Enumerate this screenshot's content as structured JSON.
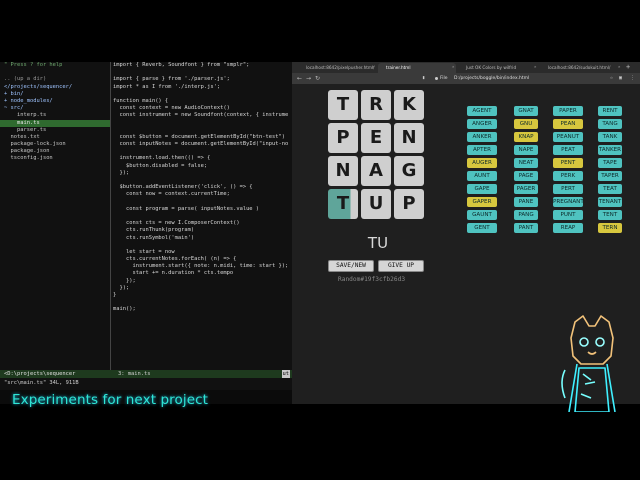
{
  "vim": {
    "tree": [
      {
        "t": "\" Press ? for help",
        "cls": "cmt"
      },
      {
        "t": "",
        "cls": ""
      },
      {
        "t": ".. (up a dir)",
        "cls": "dim"
      },
      {
        "t": "</projects/sequencer/",
        "cls": "dir"
      },
      {
        "t": "+ bin/",
        "cls": "dir"
      },
      {
        "t": "+ node_modules/",
        "cls": "dir"
      },
      {
        "t": "~ src/",
        "cls": "dir"
      },
      {
        "t": "    interp.ts",
        "cls": ""
      },
      {
        "t": "    main.ts",
        "cls": "sel"
      },
      {
        "t": "    parser.ts",
        "cls": ""
      },
      {
        "t": "  notes.txt",
        "cls": ""
      },
      {
        "t": "  package-lock.json",
        "cls": ""
      },
      {
        "t": "  package.json",
        "cls": ""
      },
      {
        "t": "  tsconfig.json",
        "cls": ""
      }
    ],
    "code": [
      "import { Reverb, Soundfont } from \"smplr\";",
      "",
      "import { parse } from './parser.js';",
      "import * as I from './interp.js';",
      "",
      "function main() {",
      "  const context = new AudioContext()",
      "  const instrument = new Soundfont(context, { instrume",
      "",
      "",
      "  const $button = document.getElementById(\"btn-test\")",
      "  const inputNotes = document.getElementById(\"input-no",
      "",
      "  instrument.load.then(() => {",
      "    $button.disabled = false;",
      "  });",
      "",
      "  $button.addEventListener('click', () => {",
      "    const now = context.currentTime;",
      "",
      "    const program = parse( inputNotes.value )",
      "",
      "    const cts = new I.ComposerContext()",
      "    cts.runThunk(program)",
      "    cts.runSymbol('main')",
      "",
      "    let start = now",
      "    cts.currentNotes.forEach( (n) => {",
      "      instrument.start({ note: n.midi, time: start });",
      "      start += n.duration * cts.tempo",
      "    });",
      "  });",
      "}",
      "",
      "main();"
    ],
    "status_left": "<D:\\projects\\sequencer",
    "status_right": "3: main.ts",
    "status_end": "ut",
    "cmdline": "\"src\\main.ts\" 34L, 911B"
  },
  "browser": {
    "tabs": [
      {
        "label": "localhost:8642/pixelpusher.html/",
        "active": false
      },
      {
        "label": "trainer.html",
        "active": true
      },
      {
        "label": "Just OK Colors by wilfrid",
        "active": false
      },
      {
        "label": "localhost:8642/sudokuit.html/",
        "active": false
      }
    ],
    "url_scheme": "File",
    "url_path": "D:/projects/boggle/bin/index.html",
    "board": [
      [
        "T",
        "R",
        "K"
      ],
      [
        "P",
        "E",
        "N"
      ],
      [
        "N",
        "A",
        "G"
      ],
      [
        "T",
        "U",
        "P"
      ]
    ],
    "highlighted_tile": {
      "row": 3,
      "col": 0
    },
    "current_word": "TU",
    "save_new_label": "SAVE/NEW",
    "give_up_label": "GIVE UP",
    "seed": "Random#19f3cfb26d3",
    "words": [
      [
        {
          "w": "AGENT",
          "f": false
        },
        {
          "w": "GNAT",
          "f": false
        },
        {
          "w": "PAPER",
          "f": false
        },
        {
          "w": "RENT",
          "f": false
        }
      ],
      [
        {
          "w": "ANGER",
          "f": false
        },
        {
          "w": "GNU",
          "f": true
        },
        {
          "w": "PEAN",
          "f": true
        },
        {
          "w": "TANG",
          "f": false
        }
      ],
      [
        {
          "w": "ANKER",
          "f": false
        },
        {
          "w": "KNAP",
          "f": true
        },
        {
          "w": "PEANUT",
          "f": false
        },
        {
          "w": "TANK",
          "f": false
        }
      ],
      [
        {
          "w": "APTER",
          "f": false
        },
        {
          "w": "NAPE",
          "f": false
        },
        {
          "w": "PEAT",
          "f": false
        },
        {
          "w": "TANKER",
          "f": false
        }
      ],
      [
        {
          "w": "AUGER",
          "f": true
        },
        {
          "w": "NEAT",
          "f": false
        },
        {
          "w": "PENT",
          "f": true
        },
        {
          "w": "TAPE",
          "f": false
        }
      ],
      [
        {
          "w": "AUNT",
          "f": false
        },
        {
          "w": "PAGE",
          "f": false
        },
        {
          "w": "PERK",
          "f": false
        },
        {
          "w": "TAPER",
          "f": false
        }
      ],
      [
        {
          "w": "GAPE",
          "f": false
        },
        {
          "w": "PAGER",
          "f": false
        },
        {
          "w": "PERT",
          "f": false
        },
        {
          "w": "TEAT",
          "f": false
        }
      ],
      [
        {
          "w": "GAPER",
          "f": true
        },
        {
          "w": "PANE",
          "f": false
        },
        {
          "w": "PREGNANT",
          "f": false
        },
        {
          "w": "TENANT",
          "f": false
        }
      ],
      [
        {
          "w": "GAUNT",
          "f": false
        },
        {
          "w": "PANG",
          "f": false
        },
        {
          "w": "PUNT",
          "f": false
        },
        {
          "w": "TENT",
          "f": false
        }
      ],
      [
        {
          "w": "GENT",
          "f": false
        },
        {
          "w": "PANT",
          "f": false
        },
        {
          "w": "REAP",
          "f": false
        },
        {
          "w": "TERN",
          "f": true
        }
      ]
    ]
  },
  "caption": "Experiments for next project",
  "colors": {
    "word_chip": "#4fc3c0",
    "found_chip": "#d7c73e",
    "caption": "#2fe6d6",
    "highlight": "#5fa59a"
  },
  "icons": [
    "back-icon",
    "forward-icon",
    "reload-icon",
    "file-info-icon",
    "star-icon",
    "menu-icon",
    "mascot-icon"
  ]
}
